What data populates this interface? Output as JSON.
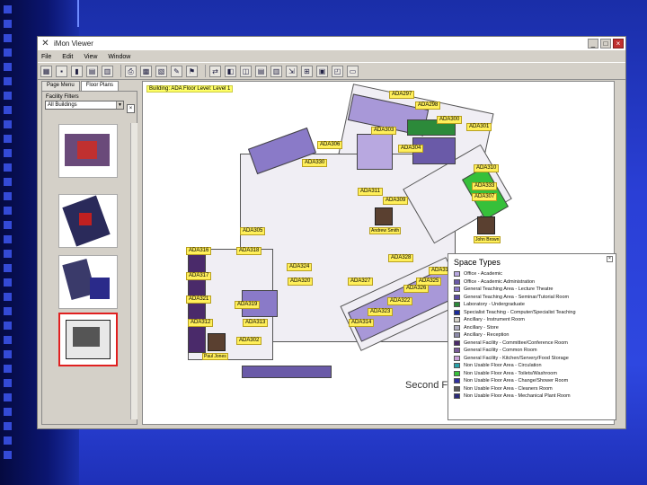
{
  "window": {
    "title": "iMon Viewer"
  },
  "menu": [
    "File",
    "Edit",
    "View",
    "Window"
  ],
  "left_panel": {
    "tabs": [
      "Page Menu",
      "Floor Plans"
    ],
    "label": "Facility Filters",
    "filter_value": "All Buildings"
  },
  "map": {
    "caption": "Building: ADA Floor Level: Level 1",
    "floor_title": "Second Floor",
    "rooms": [
      "ADA297",
      "ADA298",
      "ADA300",
      "ADA301",
      "ADA306",
      "ADA303",
      "ADA304",
      "ADA330",
      "ADA310",
      "ADA333",
      "ADA311",
      "ADA309",
      "ADA307",
      "ADA305",
      "ADA316",
      "ADA318",
      "ADA328",
      "ADA324",
      "ADA317",
      "ADA320",
      "ADA315",
      "ADA325",
      "ADA327",
      "ADA326",
      "ADA321",
      "ADA319",
      "ADA322",
      "ADA323",
      "ADA312",
      "ADA313",
      "ADA314",
      "ADA302"
    ],
    "people": [
      "Andrew Smith",
      "John Brown",
      "Paul Jones"
    ]
  },
  "legend": {
    "title": "Space Types",
    "items": [
      {
        "label": "Office - Academic",
        "color": "#b8a8e0"
      },
      {
        "label": "Office - Academic Administration",
        "color": "#6a5aa8"
      },
      {
        "label": "General Teaching Area - Lecture Theatre",
        "color": "#8a7ac8"
      },
      {
        "label": "General Teaching Area - Seminar/Tutorial Room",
        "color": "#5a4aa0"
      },
      {
        "label": "Laboratory - Undergraduate",
        "color": "#2c8a3a"
      },
      {
        "label": "Specialist Teaching - Computer/Specialist Teaching",
        "color": "#1a2a9a"
      },
      {
        "label": "Ancillary - Instrument Room",
        "color": "#d4d0c8"
      },
      {
        "label": "Ancillary - Store",
        "color": "#b0aec0"
      },
      {
        "label": "Ancillary - Reception",
        "color": "#8c8aa8"
      },
      {
        "label": "General Facility - Committee/Conference Room",
        "color": "#4a2a6a"
      },
      {
        "label": "General Facility - Common Room",
        "color": "#7a5a9a"
      },
      {
        "label": "General Facility - Kitchen/Servery/Food Storage",
        "color": "#c8a0d8"
      },
      {
        "label": "Non Usable Floor Area - Circulation",
        "color": "#2aa0a8"
      },
      {
        "label": "Non Usable Floor Area - Toilets/Washroom",
        "color": "#36c03a"
      },
      {
        "label": "Non Usable Floor Area - Change/Shower Room",
        "color": "#3030a0"
      },
      {
        "label": "Non Usable Floor Area - Cleaners Room",
        "color": "#5a5a5a"
      },
      {
        "label": "Non Usable Floor Area - Mechanical Plant Room",
        "color": "#2a2a7a"
      }
    ]
  }
}
